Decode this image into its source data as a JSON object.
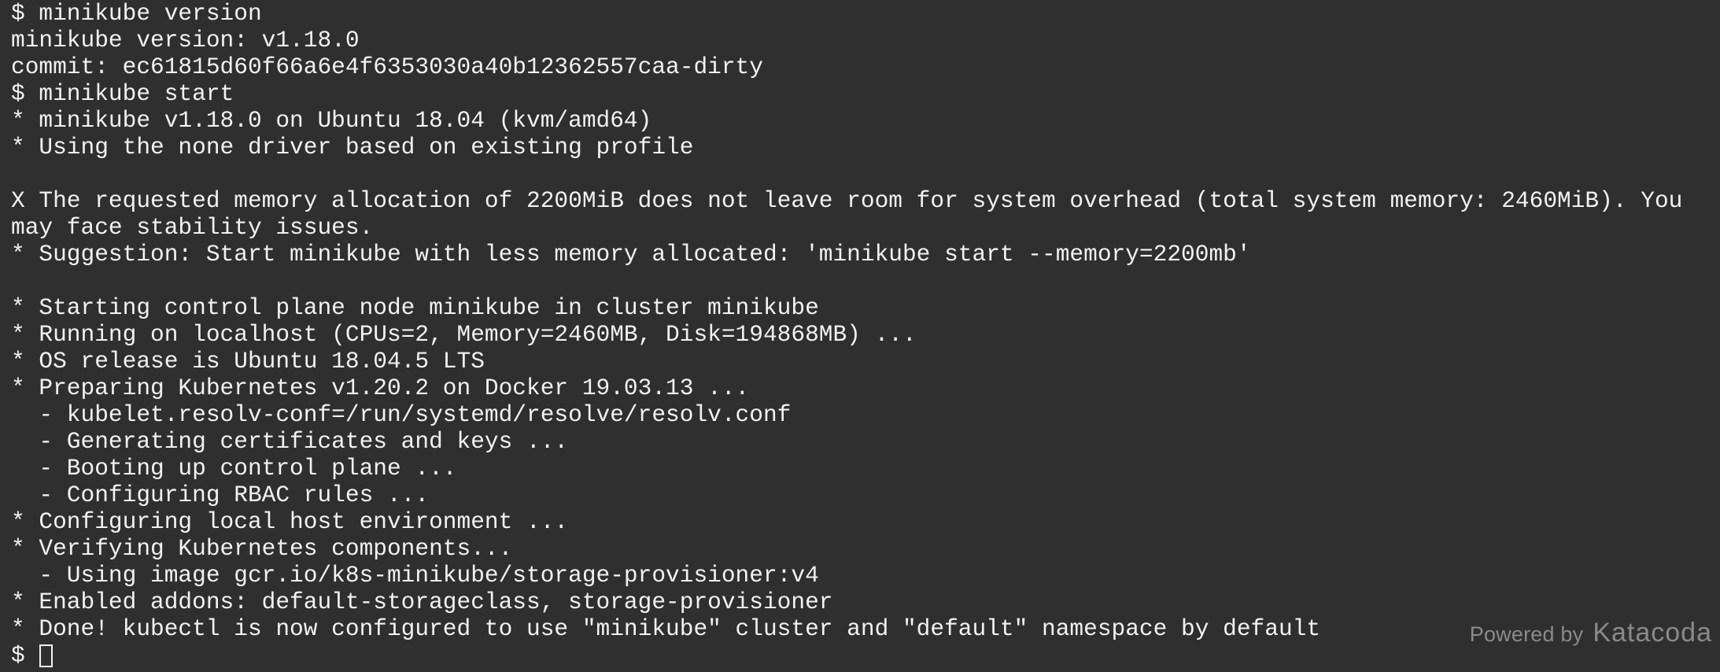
{
  "terminal": {
    "lines": [
      "$ minikube version",
      "minikube version: v1.18.0",
      "commit: ec61815d60f66a6e4f6353030a40b12362557caa-dirty",
      "$ minikube start",
      "* minikube v1.18.0 on Ubuntu 18.04 (kvm/amd64)",
      "* Using the none driver based on existing profile",
      "",
      "X The requested memory allocation of 2200MiB does not leave room for system overhead (total system memory: 2460MiB). You",
      "may face stability issues.",
      "* Suggestion: Start minikube with less memory allocated: 'minikube start --memory=2200mb'",
      "",
      "* Starting control plane node minikube in cluster minikube",
      "* Running on localhost (CPUs=2, Memory=2460MB, Disk=194868MB) ...",
      "* OS release is Ubuntu 18.04.5 LTS",
      "* Preparing Kubernetes v1.20.2 on Docker 19.03.13 ...",
      "  - kubelet.resolv-conf=/run/systemd/resolve/resolv.conf",
      "  - Generating certificates and keys ...",
      "  - Booting up control plane ...",
      "  - Configuring RBAC rules ...",
      "* Configuring local host environment ...",
      "* Verifying Kubernetes components...",
      "  - Using image gcr.io/k8s-minikube/storage-provisioner:v4",
      "* Enabled addons: default-storageclass, storage-provisioner",
      "* Done! kubectl is now configured to use \"minikube\" cluster and \"default\" namespace by default"
    ],
    "prompt": "$"
  },
  "watermark": {
    "powered_by": "Powered by",
    "brand": "Katacoda"
  }
}
